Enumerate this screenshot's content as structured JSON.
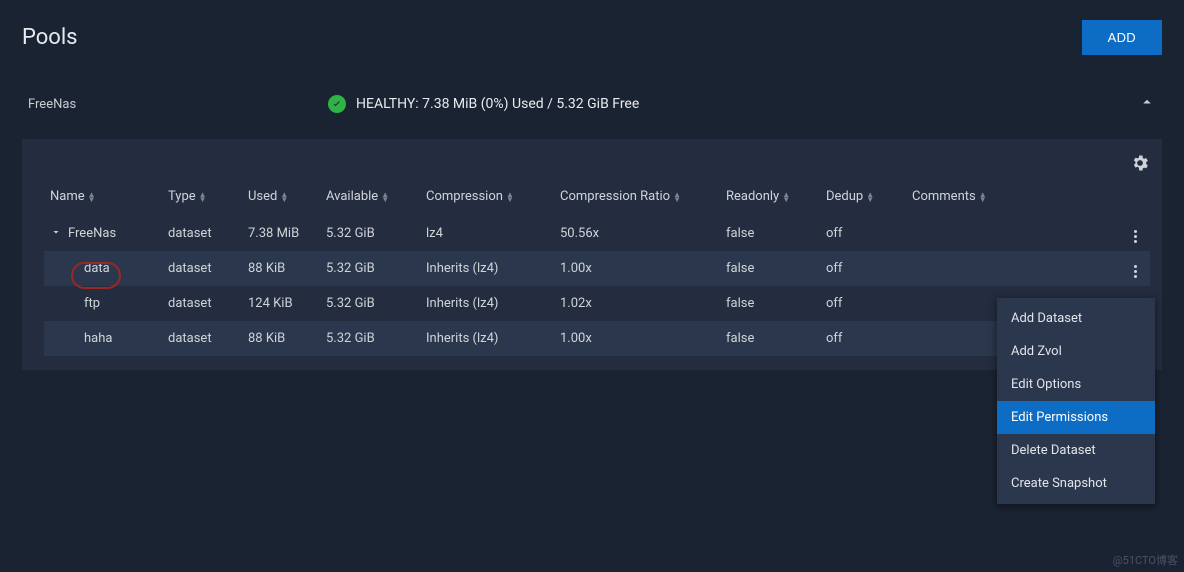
{
  "page_title": "Pools",
  "add_button": "ADD",
  "pool": {
    "name": "FreeNas",
    "health_text": "HEALTHY: 7.38 MiB (0%) Used / 5.32 GiB Free"
  },
  "columns": {
    "name": "Name",
    "type": "Type",
    "used": "Used",
    "available": "Available",
    "compression": "Compression",
    "ratio": "Compression Ratio",
    "readonly": "Readonly",
    "dedup": "Dedup",
    "comments": "Comments"
  },
  "rows": [
    {
      "name": "FreeNas",
      "type": "dataset",
      "used": "7.38 MiB",
      "available": "5.32 GiB",
      "compression": "lz4",
      "ratio": "50.56x",
      "readonly": "false",
      "dedup": "off",
      "comments": "",
      "indent": 0,
      "expandable": true
    },
    {
      "name": "data",
      "type": "dataset",
      "used": "88 KiB",
      "available": "5.32 GiB",
      "compression": "Inherits (lz4)",
      "ratio": "1.00x",
      "readonly": "false",
      "dedup": "off",
      "comments": "",
      "indent": 1,
      "expandable": false
    },
    {
      "name": "ftp",
      "type": "dataset",
      "used": "124 KiB",
      "available": "5.32 GiB",
      "compression": "Inherits (lz4)",
      "ratio": "1.02x",
      "readonly": "false",
      "dedup": "off",
      "comments": "",
      "indent": 1,
      "expandable": false
    },
    {
      "name": "haha",
      "type": "dataset",
      "used": "88 KiB",
      "available": "5.32 GiB",
      "compression": "Inherits (lz4)",
      "ratio": "1.00x",
      "readonly": "false",
      "dedup": "off",
      "comments": "",
      "indent": 1,
      "expandable": false
    }
  ],
  "context_menu": {
    "items": [
      {
        "label": "Add Dataset",
        "selected": false
      },
      {
        "label": "Add Zvol",
        "selected": false
      },
      {
        "label": "Edit Options",
        "selected": false
      },
      {
        "label": "Edit Permissions",
        "selected": true
      },
      {
        "label": "Delete Dataset",
        "selected": false
      },
      {
        "label": "Create Snapshot",
        "selected": false
      }
    ]
  },
  "watermark": "@51CTO博客"
}
